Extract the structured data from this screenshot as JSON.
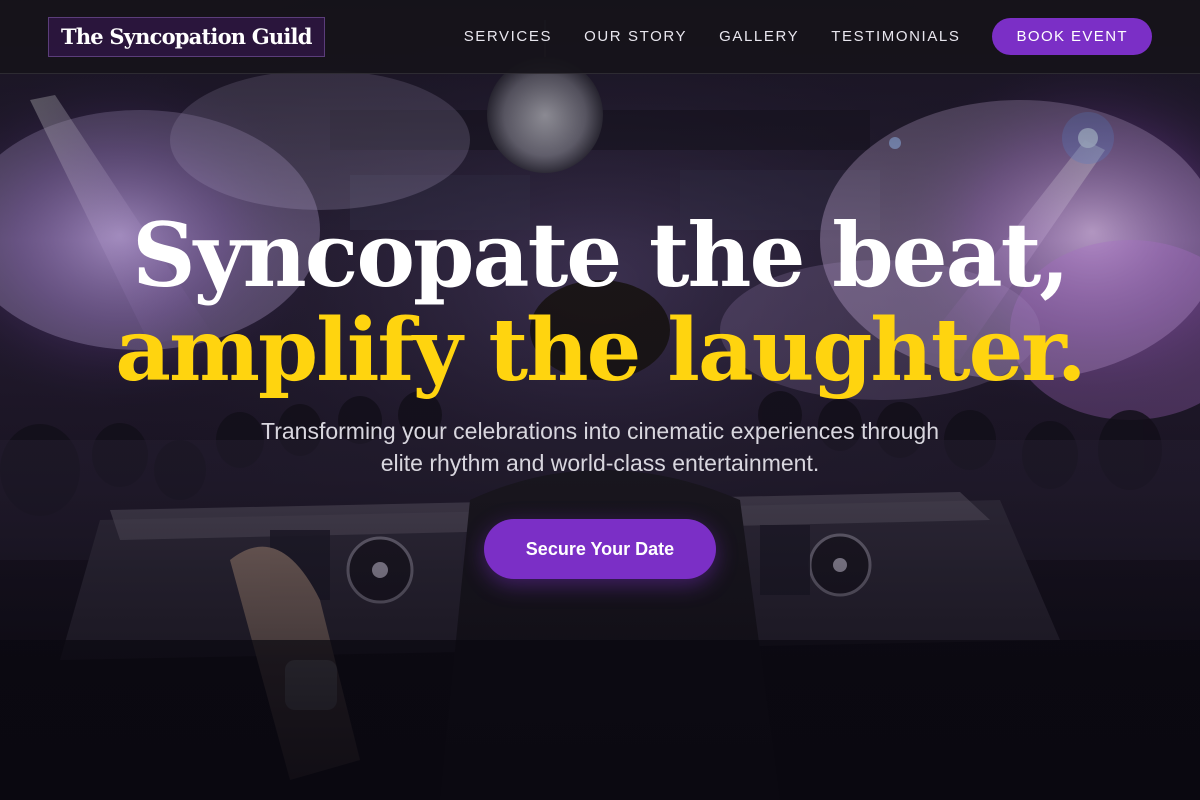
{
  "navbar": {
    "brand": "The Syncopation Guild",
    "links": [
      {
        "label": "SERVICES"
      },
      {
        "label": "OUR STORY"
      },
      {
        "label": "GALLERY"
      },
      {
        "label": "TESTIMONIALS"
      }
    ],
    "cta_label": "BOOK EVENT"
  },
  "hero": {
    "headline_line1": "Syncopate the beat,",
    "headline_line2": "amplify the laughter.",
    "tagline": "Transforming your celebrations into cinematic experiences through elite rhythm and world-class entertainment.",
    "cta_label": "Secure Your Date",
    "background_image": "nightclub-dj-crowd-photo"
  },
  "colors": {
    "accent_purple": "#7b2fc6",
    "headline_yellow": "#ffd40f",
    "navbar_bg": "#16141a",
    "text_white": "#ffffff"
  }
}
